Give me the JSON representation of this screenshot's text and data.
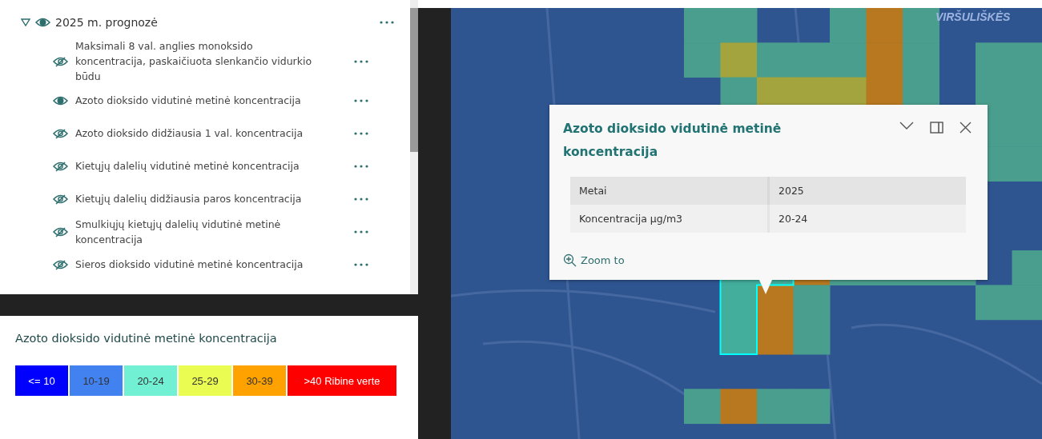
{
  "layer_list": {
    "group": {
      "title": "2025 m. prognozė",
      "expanded": true,
      "visible": true,
      "children": [
        {
          "title": "Maksimali 8 val. anglies monoksido koncentracija, paskaičiuota slenkančio vidurkio būdu",
          "visible": false
        },
        {
          "title": "Azoto dioksido vidutinė metinė koncentracija",
          "visible": true
        },
        {
          "title": "Azoto dioksido didžiausia 1 val. koncentracija",
          "visible": false
        },
        {
          "title": "Kietųjų dalelių vidutinė metinė koncentracija",
          "visible": false
        },
        {
          "title": "Kietųjų dalelių didžiausia paros koncentracija",
          "visible": false
        },
        {
          "title": "Smulkiųjų kietųjų dalelių vidutinė metinė koncentracija",
          "visible": false
        },
        {
          "title": "Sieros dioksido vidutinė metinė koncentracija",
          "visible": false
        }
      ]
    }
  },
  "legend": {
    "title": "Azoto dioksido vidutinė metinė koncentracija",
    "classes": [
      {
        "label": "<= 10",
        "color": "#0000ff"
      },
      {
        "label": "10-19",
        "color": "#4282f0"
      },
      {
        "label": "20-24",
        "color": "#72f0d4"
      },
      {
        "label": "25-29",
        "color": "#eafc52"
      },
      {
        "label": "30-39",
        "color": "#ffa200"
      },
      {
        "label": ">40 Ribine verte",
        "color": "#ff0000"
      }
    ]
  },
  "map": {
    "place_label": "VIRŠULIŠKĖS",
    "popup": {
      "title": "Azoto dioksido vidutinė metinė koncentracija",
      "rows": [
        {
          "field": "Metai",
          "value": "2025"
        },
        {
          "field": "Koncentracija µg/m3",
          "value": "20-24"
        }
      ],
      "action": "Zoom to"
    }
  }
}
